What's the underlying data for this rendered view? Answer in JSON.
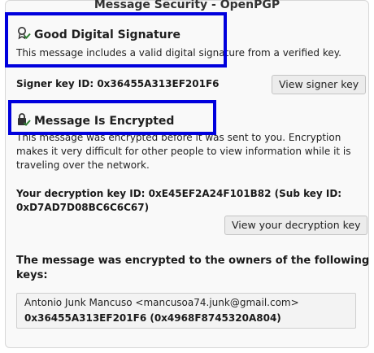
{
  "window": {
    "title": "Message Security - OpenPGP"
  },
  "signature": {
    "heading": "Good Digital Signature",
    "description": "This message includes a valid digital signature from a verified key.",
    "signer_key_label": "Signer key ID: 0x36455A313EF201F6",
    "view_signer_button": "View signer key",
    "icon": "signature-check-icon",
    "icon_color": "#2e7d32"
  },
  "encryption": {
    "heading": "Message Is Encrypted",
    "description_line1": "This message was encrypted before it was sent to you. Encryption",
    "description_line2": "makes it very difficult for other people to view information while it is",
    "description_line3": "traveling over the network.",
    "decryption_key_line1": "Your decryption key ID: 0xE45EF2A24F101B82 (Sub key ID:",
    "decryption_key_line2": "0xD7AD7D08BC6C6C67)",
    "view_decryption_button": "View your decryption key",
    "icon": "lock-check-icon",
    "icon_color": "#2e7d32"
  },
  "recipients": {
    "heading_line1": "The message was encrypted to the owners of the following",
    "heading_line2": "keys:",
    "items": [
      {
        "name": "Antonio Junk Mancuso <mancusoa74.junk@gmail.com>",
        "keys": "0x36455A313EF201F6 (0x4968F8745320A804)"
      }
    ]
  },
  "highlight_color": "#0000dd"
}
